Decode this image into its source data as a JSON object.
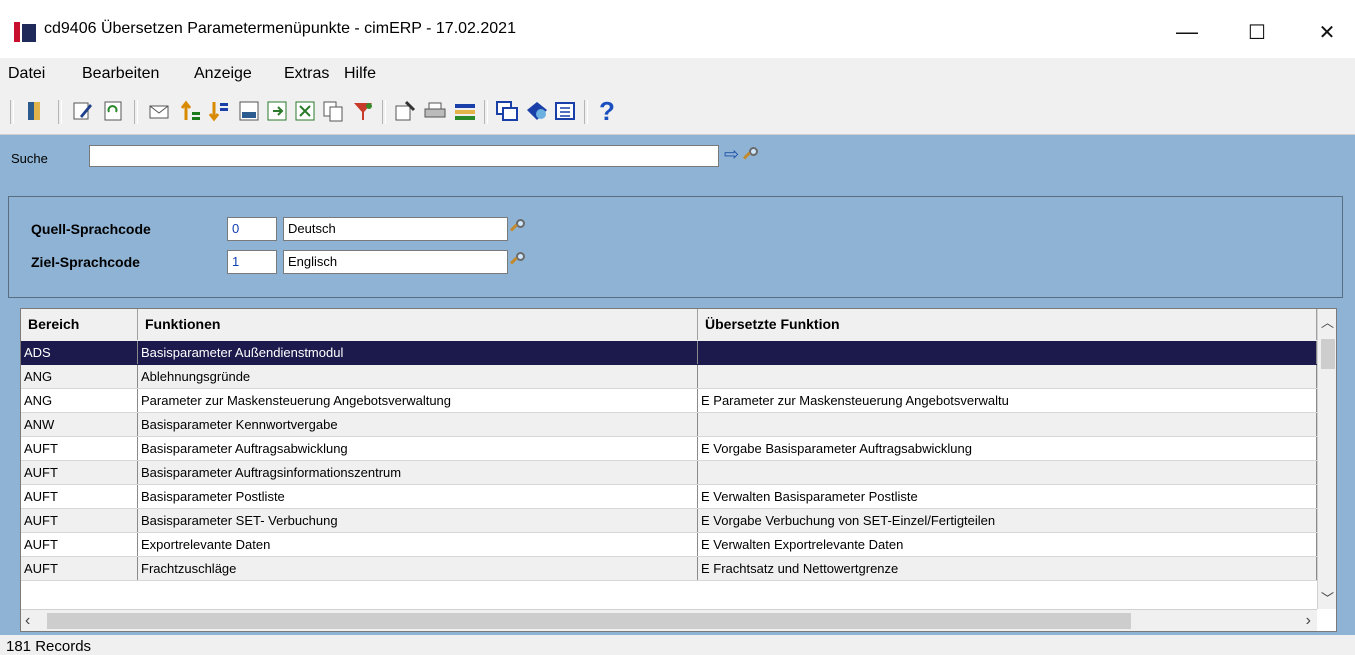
{
  "window": {
    "title": "cd9406 Übersetzen Parametermenüpunkte - cimERP - 17.02.2021",
    "minimize": "—",
    "maximize": "☐",
    "close": "✕"
  },
  "menu": [
    "Datei",
    "Bearbeiten",
    "Anzeige",
    "Extras",
    "Hilfe"
  ],
  "toolbar": {
    "icons": [
      "exit-icon",
      "edit-icon",
      "refresh-icon",
      "mail-icon",
      "sort-ascending-icon",
      "sort-descending-icon",
      "calculator-icon",
      "export-icon",
      "excel-icon",
      "copy-icon",
      "filter-icon",
      "properties-icon",
      "print-icon",
      "list-icon",
      "windows-icon",
      "notes-icon",
      "grid-icon",
      "help-icon"
    ],
    "help_glyph": "?"
  },
  "search": {
    "label": "Suche",
    "value": ""
  },
  "params": {
    "source_label": "Quell-Sprachcode",
    "source_code": "0",
    "source_name": "Deutsch",
    "target_label": "Ziel-Sprachcode",
    "target_code": "1",
    "target_name": "Englisch"
  },
  "table": {
    "columns": [
      "Bereich",
      "Funktionen",
      "Übersetzte Funktion"
    ],
    "rows": [
      [
        "ADS",
        "Basisparameter Außendienstmodul",
        ""
      ],
      [
        "ANG",
        "Ablehnungsgründe",
        ""
      ],
      [
        "ANG",
        "Parameter zur Maskensteuerung Angebotsverwaltung",
        "E  Parameter zur Maskensteuerung Angebotsverwaltu"
      ],
      [
        "ANW",
        "Basisparameter Kennwortvergabe",
        ""
      ],
      [
        "AUFT",
        "Basisparameter Auftragsabwicklung",
        "E  Vorgabe Basisparameter Auftragsabwicklung"
      ],
      [
        "AUFT",
        "Basisparameter Auftragsinformationszentrum",
        ""
      ],
      [
        "AUFT",
        "Basisparameter Postliste",
        "E  Verwalten Basisparameter Postliste"
      ],
      [
        "AUFT",
        "Basisparameter SET- Verbuchung",
        "E  Vorgabe Verbuchung von SET-Einzel/Fertigteilen"
      ],
      [
        "AUFT",
        "Exportrelevante Daten",
        "E  Verwalten Exportrelevante Daten"
      ],
      [
        "AUFT",
        "Frachtzuschläge",
        "E  Frachtsatz und Nettowertgrenze"
      ]
    ],
    "selected_row": 0
  },
  "status": {
    "records": "181 Records"
  }
}
